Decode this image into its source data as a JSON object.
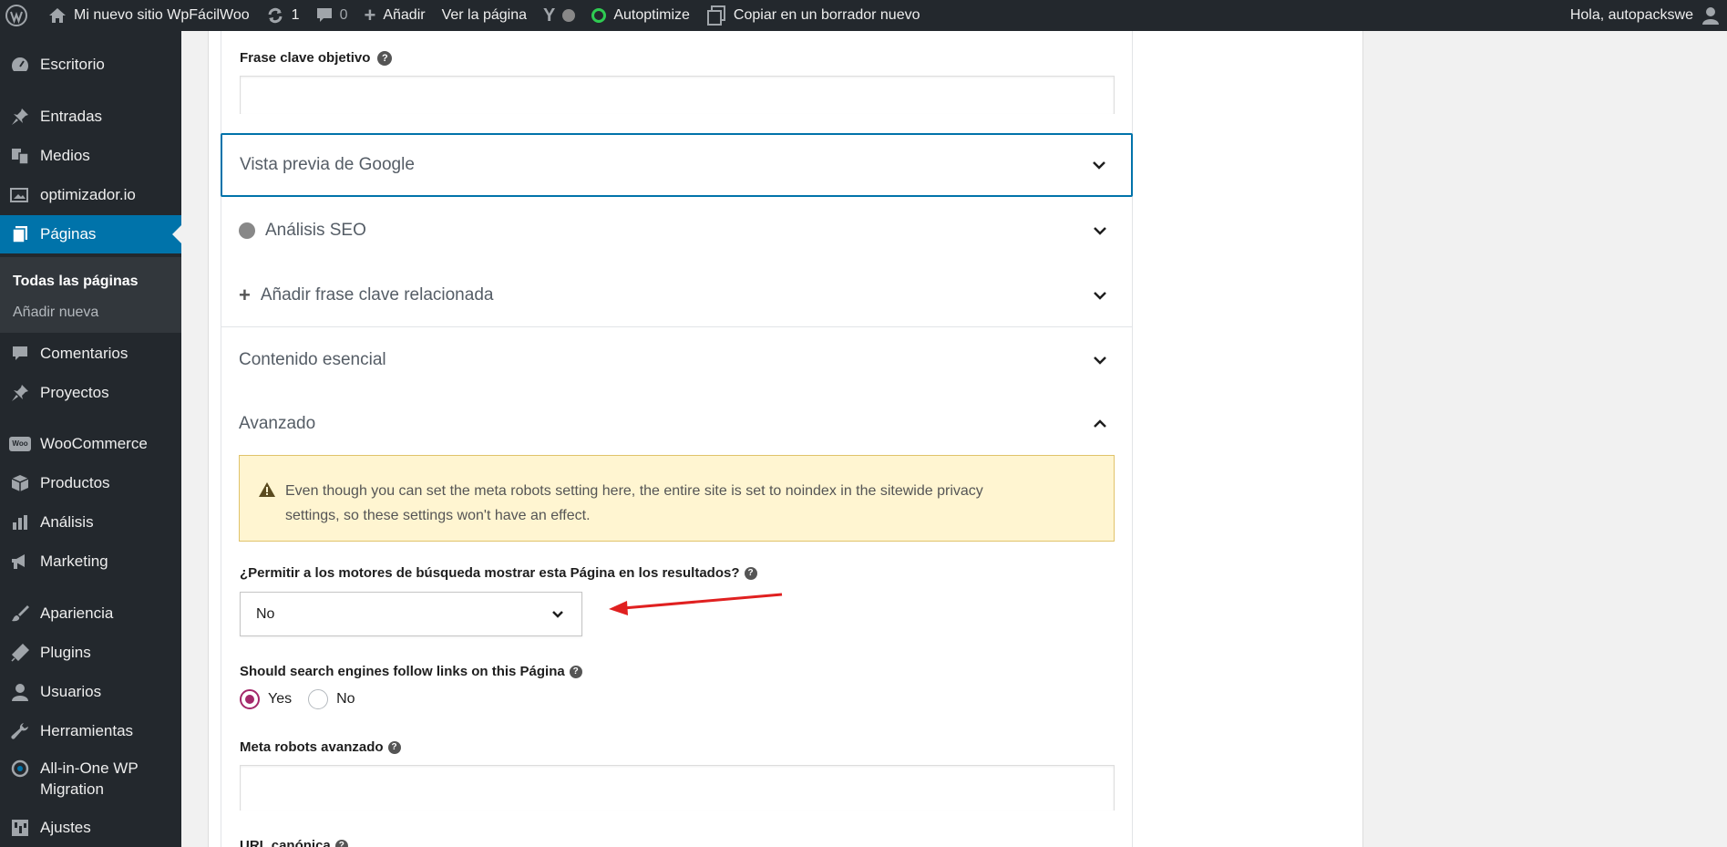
{
  "admin_bar": {
    "site_name": "Mi nuevo sitio WpFácilWoo",
    "updates_count": "1",
    "comments_count": "0",
    "new_label": "Añadir",
    "view_page": "Ver la página",
    "autoptimize": "Autoptimize",
    "copy_draft": "Copiar en un borrador nuevo",
    "greeting": "Hola, autopackswe"
  },
  "sidebar": {
    "items": [
      {
        "label": "Escritorio",
        "icon": "dashboard-icon"
      },
      {
        "label": "Entradas",
        "icon": "pin-icon"
      },
      {
        "label": "Medios",
        "icon": "media-icon"
      },
      {
        "label": "optimizador.io",
        "icon": "image-icon"
      },
      {
        "label": "Páginas",
        "icon": "pages-icon"
      },
      {
        "label": "Comentarios",
        "icon": "comment-icon"
      },
      {
        "label": "Proyectos",
        "icon": "pin-icon"
      },
      {
        "label": "WooCommerce",
        "icon": "woo-icon"
      },
      {
        "label": "Productos",
        "icon": "box-icon"
      },
      {
        "label": "Análisis",
        "icon": "bar-chart-icon"
      },
      {
        "label": "Marketing",
        "icon": "megaphone-icon"
      },
      {
        "label": "Apariencia",
        "icon": "brush-icon"
      },
      {
        "label": "Plugins",
        "icon": "plug-icon"
      },
      {
        "label": "Usuarios",
        "icon": "user-icon"
      },
      {
        "label": "Herramientas",
        "icon": "wrench-icon"
      },
      {
        "label": "All-in-One WP",
        "label2": "Migration",
        "icon": "migration-icon"
      },
      {
        "label": "Ajustes",
        "icon": "settings-icon"
      }
    ],
    "submenu": {
      "all_pages": "Todas las páginas",
      "add_new": "Añadir nueva"
    }
  },
  "seo": {
    "focus_keyphrase_label": "Frase clave objetivo",
    "google_preview": "Vista previa de Google",
    "seo_analysis": "Análisis SEO",
    "related_keyphrase": "Añadir frase clave relacionada",
    "cornerstone": "Contenido esencial",
    "advanced": "Avanzado",
    "notice_line1": "Even though you can set the meta robots setting here, the entire site is set to noindex in the sitewide privacy",
    "notice_line2": "settings, so these settings won't have an effect.",
    "allow_search_label": "¿Permitir a los motores de búsqueda mostrar esta Página en los resultados?",
    "allow_search_value": "No",
    "follow_links_label": "Should search engines follow links on this Página",
    "follow_yes": "Yes",
    "follow_no": "No",
    "follow_selected": "Yes",
    "meta_robots_label": "Meta robots avanzado",
    "canonical_label": "URL canónica"
  },
  "colors": {
    "accent": "#0073aa",
    "radio": "#a4286a",
    "annotation_arrow": "#e02020",
    "adminbar": "#23282d"
  }
}
